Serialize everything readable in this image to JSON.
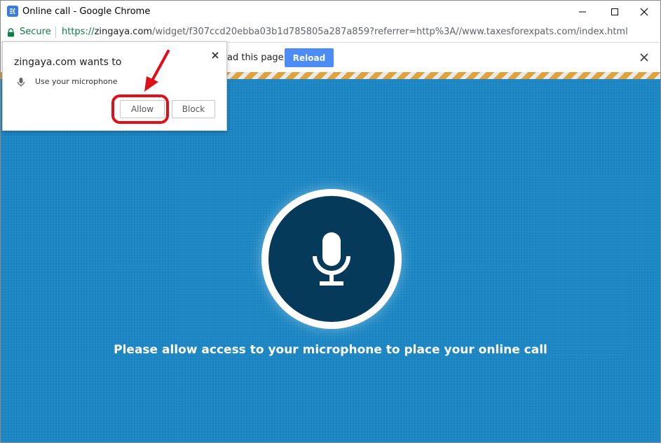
{
  "window": {
    "title": "Online call - Google Chrome"
  },
  "address_bar": {
    "secure_label": "Secure",
    "url_scheme": "https://",
    "url_host": "zingaya.com",
    "url_path": "/widget/f307ccd20ebba03b1d785805a287a859?referrer=http%3A//www.taxesforexpats.com/index.html"
  },
  "infobar": {
    "partial_text": "ad this page",
    "reload_label": "Reload"
  },
  "popup": {
    "title": "zingaya.com wants to",
    "permission_label": "Use your microphone",
    "allow_label": "Allow",
    "block_label": "Block"
  },
  "main": {
    "prompt": "Please allow access to your microphone to place your online call"
  },
  "colors": {
    "main_bg": "#1b88c6",
    "mic_circle": "#053a5a",
    "reload_btn": "#4c8cf5",
    "secure_green": "#0b8043",
    "annotation_red": "#e0101a"
  },
  "icons": [
    "app-icon",
    "minimize-icon",
    "maximize-icon",
    "close-icon",
    "lock-icon",
    "microphone-icon",
    "arrow-icon"
  ]
}
